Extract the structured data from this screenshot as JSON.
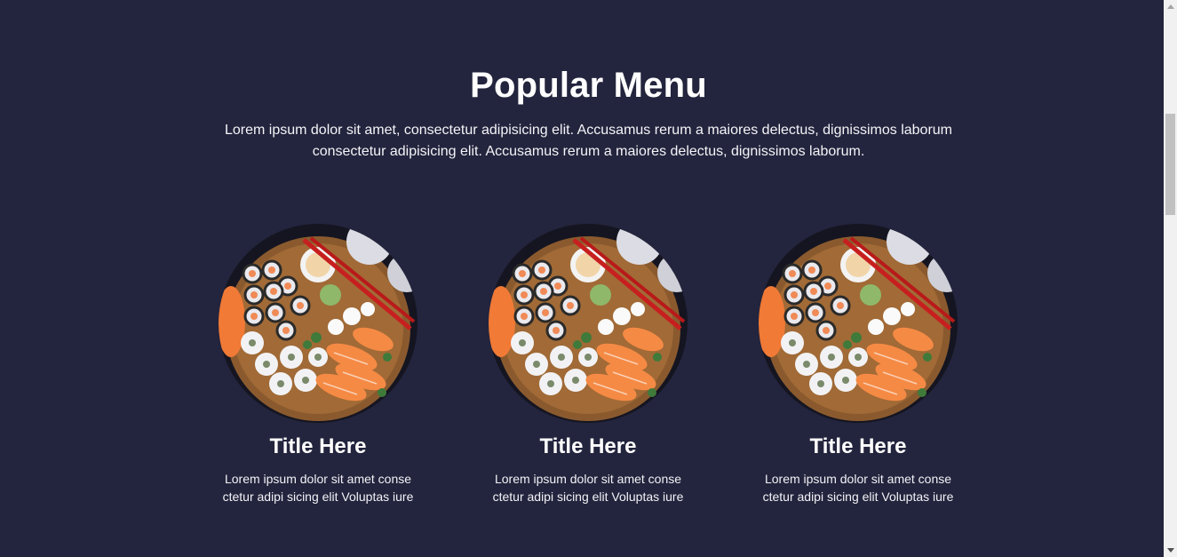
{
  "section": {
    "title": "Popular Menu",
    "subtitle": "Lorem ipsum dolor sit amet, consectetur adipisicing elit. Accusamus rerum a maiores delectus, dignissimos laborum consectetur adipisicing elit. Accusamus rerum a maiores delectus, dignissimos laborum."
  },
  "cards": [
    {
      "image": "sushi-platter-image",
      "title": "Title Here",
      "description": "Lorem ipsum dolor sit amet conse ctetur adipi sicing elit Voluptas iure"
    },
    {
      "image": "sushi-platter-image",
      "title": "Title Here",
      "description": "Lorem ipsum dolor sit amet conse ctetur adipi sicing elit Voluptas iure"
    },
    {
      "image": "sushi-platter-image",
      "title": "Title Here",
      "description": "Lorem ipsum dolor sit amet conse ctetur adipi sicing elit Voluptas iure"
    }
  ],
  "colors": {
    "background": "#23243d",
    "text": "#ffffff",
    "scrollbar_track": "#f1f1f1",
    "scrollbar_thumb": "#c1c1c1"
  },
  "icons": {
    "scroll_up": "triangle-up-icon",
    "scroll_down": "triangle-down-icon"
  }
}
